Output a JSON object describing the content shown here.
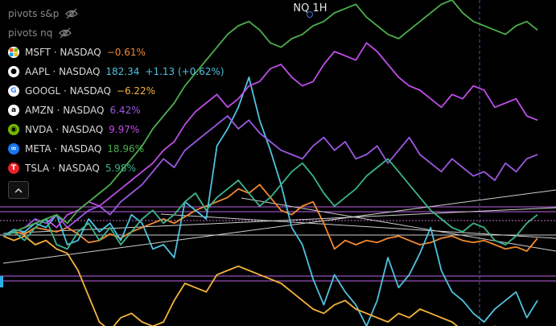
{
  "chart_title": "NQ 1H",
  "toggles": [
    {
      "label": "pivots s&p",
      "icon": "eye-off-icon"
    },
    {
      "label": "pivots nq",
      "icon": "eye-off-icon"
    }
  ],
  "symbols": [
    {
      "name": "MSFT · NASDAQ",
      "value": "−0.61%",
      "extra": "",
      "color": "#f28a30",
      "logo": "microsoft-logo-icon"
    },
    {
      "name": "AAPL · NASDAQ",
      "value": "182.34",
      "extra": "+1.13 (+0.62%)",
      "color": "#4fc3e0",
      "logo": "apple-logo-icon"
    },
    {
      "name": "GOOGL · NASDAQ",
      "value": "−6.22%",
      "extra": "",
      "color": "#f5b43c",
      "logo": "google-logo-icon"
    },
    {
      "name": "AMZN · NASDAQ",
      "value": "6.42%",
      "extra": "",
      "color": "#9b59e0",
      "logo": "amazon-logo-icon"
    },
    {
      "name": "NVDA · NASDAQ",
      "value": "9.97%",
      "extra": "",
      "color": "#c04ce8",
      "logo": "nvidia-logo-icon"
    },
    {
      "name": "META · NASDAQ",
      "value": "18.96%",
      "extra": "",
      "color": "#4cae4c",
      "logo": "meta-logo-icon"
    },
    {
      "name": "TSLA · NASDAQ",
      "value": "5.98%",
      "extra": "",
      "color": "#3cb48c",
      "logo": "tesla-logo-icon"
    }
  ],
  "collapse_icon": "chevron-up-icon",
  "chart_data": {
    "type": "line",
    "title": "NQ 1H",
    "x": [
      0,
      1,
      2,
      3,
      4,
      5,
      6,
      7,
      8,
      9,
      10,
      11,
      12,
      13,
      14,
      15,
      16,
      17,
      18,
      19,
      20,
      21,
      22,
      23,
      24,
      25,
      26,
      27,
      28,
      29,
      30,
      31,
      32,
      33,
      34,
      35,
      36,
      37,
      38,
      39,
      40,
      41,
      42,
      43,
      44,
      45,
      46,
      47,
      48,
      49,
      50
    ],
    "ylim": [
      -40,
      110
    ],
    "grid": false,
    "series": [
      {
        "name": "MSFT",
        "color": "#f28a30",
        "values": [
          0,
          2,
          1,
          4,
          3,
          2,
          4,
          1,
          -3,
          -2,
          1,
          -1,
          2,
          4,
          6,
          8,
          6,
          9,
          12,
          14,
          16,
          18,
          22,
          20,
          24,
          18,
          12,
          10,
          14,
          16,
          6,
          -6,
          -2,
          -4,
          -2,
          -3,
          -1,
          0,
          -2,
          -4,
          -3,
          -1,
          0,
          -2,
          -3,
          -2,
          -4,
          -6,
          -5,
          -7,
          -1
        ]
      },
      {
        "name": "AAPL",
        "color": "#4fc3e0",
        "values": [
          0,
          3,
          2,
          6,
          4,
          10,
          -4,
          -2,
          8,
          2,
          6,
          -2,
          10,
          6,
          -6,
          -4,
          -10,
          16,
          12,
          8,
          42,
          50,
          60,
          74,
          54,
          40,
          24,
          4,
          -4,
          -20,
          -32,
          -18,
          -26,
          -32,
          -42,
          -30,
          -10,
          -24,
          -18,
          -8,
          4,
          -16,
          -26,
          -30,
          -36,
          -40,
          -34,
          -30,
          -26,
          -38,
          -30
        ]
      },
      {
        "name": "GOOGL",
        "color": "#f5b43c",
        "values": [
          0,
          -2,
          0,
          -4,
          -2,
          -6,
          -8,
          -16,
          -28,
          -40,
          -44,
          -38,
          -36,
          -40,
          -42,
          -40,
          -30,
          -22,
          -24,
          -26,
          -18,
          -16,
          -14,
          -16,
          -18,
          -20,
          -22,
          -26,
          -30,
          -34,
          -36,
          -32,
          -30,
          -34,
          -36,
          -38,
          -40,
          -36,
          -38,
          -34,
          -36,
          -38,
          -40,
          -44,
          -46,
          -44,
          -42,
          -46,
          -48,
          -46,
          -44
        ]
      },
      {
        "name": "AMZN",
        "color": "#9b59e0",
        "values": [
          0,
          2,
          4,
          8,
          6,
          10,
          4,
          8,
          12,
          14,
          10,
          16,
          20,
          24,
          30,
          36,
          32,
          40,
          44,
          48,
          52,
          56,
          50,
          54,
          48,
          44,
          40,
          38,
          36,
          42,
          46,
          40,
          44,
          36,
          38,
          42,
          34,
          40,
          46,
          38,
          34,
          30,
          36,
          32,
          28,
          30,
          26,
          34,
          30,
          36,
          38
        ]
      },
      {
        "name": "NVDA",
        "color": "#c04ce8",
        "values": [
          0,
          2,
          4,
          6,
          8,
          4,
          10,
          12,
          16,
          14,
          18,
          22,
          26,
          30,
          34,
          40,
          44,
          52,
          58,
          62,
          66,
          60,
          64,
          70,
          72,
          78,
          80,
          74,
          70,
          72,
          80,
          86,
          84,
          82,
          90,
          86,
          80,
          74,
          70,
          68,
          64,
          60,
          66,
          64,
          70,
          68,
          60,
          62,
          64,
          56,
          54
        ]
      },
      {
        "name": "META",
        "color": "#4cae4c",
        "values": [
          0,
          2,
          4,
          6,
          8,
          10,
          6,
          12,
          16,
          20,
          24,
          30,
          36,
          42,
          50,
          56,
          62,
          70,
          76,
          82,
          88,
          94,
          98,
          100,
          96,
          90,
          88,
          92,
          94,
          98,
          100,
          104,
          106,
          108,
          102,
          98,
          94,
          92,
          96,
          100,
          104,
          108,
          110,
          104,
          100,
          98,
          96,
          94,
          98,
          100,
          96
        ]
      },
      {
        "name": "TSLA",
        "color": "#3cb48c",
        "values": [
          0,
          2,
          -2,
          4,
          8,
          -4,
          -6,
          2,
          6,
          -2,
          4,
          -4,
          2,
          8,
          12,
          6,
          10,
          16,
          20,
          12,
          18,
          22,
          26,
          20,
          14,
          18,
          24,
          30,
          34,
          28,
          20,
          14,
          18,
          22,
          28,
          32,
          36,
          30,
          24,
          18,
          12,
          8,
          4,
          2,
          6,
          4,
          -2,
          -4,
          0,
          6,
          10
        ]
      }
    ]
  }
}
